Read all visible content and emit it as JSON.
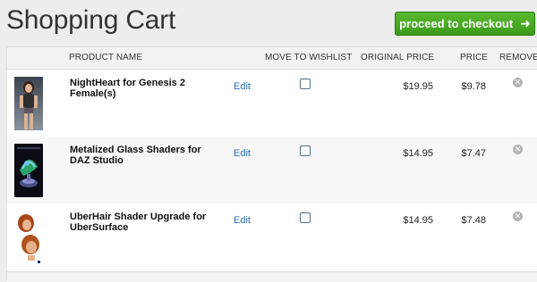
{
  "page": {
    "title": "Shopping Cart"
  },
  "checkout": {
    "label": "proceed to checkout",
    "arrow": "➜"
  },
  "headers": {
    "product_name": "PRODUCT NAME",
    "move_to_wishlist": "MOVE TO WISHLIST",
    "original_price": "ORIGINAL PRICE",
    "price": "PRICE",
    "remove": "REMOVE"
  },
  "items": [
    {
      "name": "NightHeart for Genesis 2 Female(s)",
      "edit": "Edit",
      "original_price": "$19.95",
      "price": "$9.78",
      "wishlist_checked": false,
      "thumb_icon": "female-figure-thumbnail"
    },
    {
      "name": "Metalized Glass Shaders for DAZ Studio",
      "edit": "Edit",
      "original_price": "$14.95",
      "price": "$7.47",
      "wishlist_checked": false,
      "thumb_icon": "glass-shader-thumbnail"
    },
    {
      "name": "UberHair Shader Upgrade for UberSurface",
      "edit": "Edit",
      "original_price": "$14.95",
      "price": "$7.48",
      "wishlist_checked": false,
      "thumb_icon": "hair-shader-thumbnail"
    }
  ],
  "colors": {
    "accent_green": "#4aa824",
    "link_blue": "#2a6fba",
    "row_alt": "#f7f7f7"
  },
  "icons": {
    "remove": "remove-x-icon",
    "checkout_arrow": "arrow-right-icon"
  }
}
